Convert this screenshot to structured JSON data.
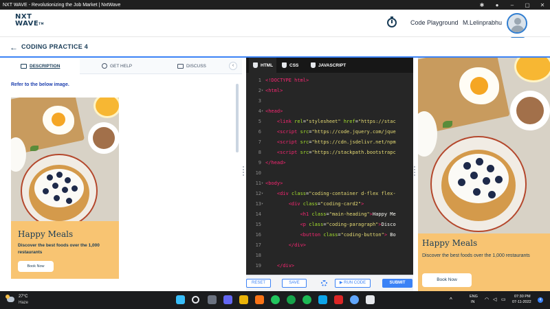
{
  "window": {
    "title": "NXT WAVE - Revolutionizing the Job Market | NxtWave"
  },
  "header": {
    "logo_line1": "NXT",
    "logo_line2": "WAVE",
    "logo_tm": "TM",
    "code_playground": "Code Playground",
    "username": "M.Lelinprabhu",
    "avatar_badge": "SMART"
  },
  "practice": {
    "title": "CODING PRACTICE 4"
  },
  "left_tabs": {
    "description": "DESCRIPTION",
    "get_help": "GET HELP",
    "discuss": "DISCUSS"
  },
  "description": {
    "refer": "Refer to the below image."
  },
  "preview_card": {
    "heading": "Happy Meals",
    "paragraph": "Discover the best foods over the 1,000 restaurants",
    "button": "Book Now"
  },
  "editor": {
    "tabs": [
      "HTML",
      "CSS",
      "JAVASCRIPT"
    ],
    "lines": [
      {
        "n": "1",
        "fold": "",
        "html": "<span class=\"tag\">&lt;!DOCTYPE html&gt;</span>"
      },
      {
        "n": "2",
        "fold": "▾",
        "html": "<span class=\"tag\">&lt;html&gt;</span>"
      },
      {
        "n": "3",
        "fold": "",
        "html": ""
      },
      {
        "n": "4",
        "fold": "▾",
        "html": "<span class=\"tag\">&lt;head&gt;</span>"
      },
      {
        "n": "5",
        "fold": "",
        "html": "    <span class=\"tag\">&lt;link</span> <span class=\"attr\">rel</span>=<span class=\"str\">\"stylesheet\"</span> <span class=\"attr\">href</span>=<span class=\"str\">\"https://stac</span>"
      },
      {
        "n": "6",
        "fold": "",
        "html": "    <span class=\"tag\">&lt;script</span> <span class=\"attr\">src</span>=<span class=\"str\">\"https://code.jquery.com/jque</span>"
      },
      {
        "n": "7",
        "fold": "",
        "html": "    <span class=\"tag\">&lt;script</span> <span class=\"attr\">src</span>=<span class=\"str\">\"https://cdn.jsdelivr.net/npm</span>"
      },
      {
        "n": "8",
        "fold": "",
        "html": "    <span class=\"tag\">&lt;script</span> <span class=\"attr\">src</span>=<span class=\"str\">\"https://stackpath.bootstrapc</span>"
      },
      {
        "n": "9",
        "fold": "",
        "html": "<span class=\"tag\">&lt;/head&gt;</span>"
      },
      {
        "n": "10",
        "fold": "",
        "html": ""
      },
      {
        "n": "11",
        "fold": "▾",
        "html": "<span class=\"tag\">&lt;body&gt;</span>"
      },
      {
        "n": "12",
        "fold": "▾",
        "html": "    <span class=\"tag\">&lt;div</span> <span class=\"attr\">class</span>=<span class=\"str\">\"coding-container d-flex flex-</span>"
      },
      {
        "n": "13",
        "fold": "▾",
        "html": "        <span class=\"tag\">&lt;div</span> <span class=\"attr\">class</span>=<span class=\"str\">\"coding-card2\"</span><span class=\"tag\">&gt;</span>"
      },
      {
        "n": "14",
        "fold": "",
        "html": "            <span class=\"tag\">&lt;h1</span> <span class=\"attr\">class</span>=<span class=\"str\">\"main-heading\"</span><span class=\"tag\">&gt;</span>Happy Me"
      },
      {
        "n": "15",
        "fold": "",
        "html": "            <span class=\"tag\">&lt;p</span> <span class=\"attr\">class</span>=<span class=\"str\">\"coding-paragraph\"</span><span class=\"tag\">&gt;</span>Disco"
      },
      {
        "n": "16",
        "fold": "",
        "html": "            <span class=\"tag\">&lt;button</span> <span class=\"attr\">class</span>=<span class=\"str\">\"coding-button\"</span><span class=\"tag\">&gt;</span> Bo"
      },
      {
        "n": "17",
        "fold": "",
        "html": "        <span class=\"tag\">&lt;/div&gt;</span>"
      },
      {
        "n": "18",
        "fold": "",
        "html": ""
      },
      {
        "n": "19",
        "fold": "",
        "html": "    <span class=\"tag\">&lt;/div&gt;</span>"
      }
    ]
  },
  "editor_bar": {
    "reset": "RESET",
    "save": "SAVE",
    "run_code": "▶ RUN CODE",
    "submit": "SUBMIT"
  },
  "taskbar": {
    "temperature": "27°C",
    "weather": "Haze",
    "lang1": "ENG",
    "lang2": "IN",
    "time": "07:30 PM",
    "date": "07-11-2022",
    "notifications": "4"
  },
  "colors": {
    "brand_navy": "#183b56",
    "accent_blue": "#3b82f6",
    "card_bg": "#f8c472",
    "editor_bg": "#262626"
  }
}
